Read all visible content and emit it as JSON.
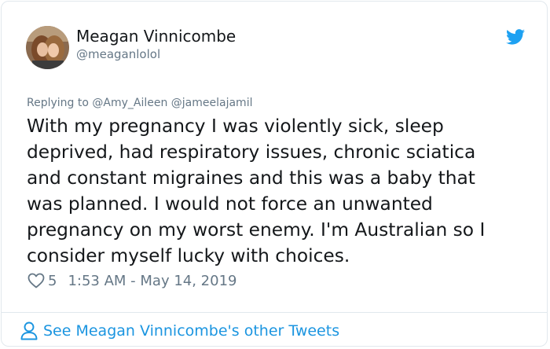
{
  "user": {
    "display_name": "Meagan Vinnicombe",
    "handle": "@meaganlolol",
    "avatar_icon": "profile-photo"
  },
  "brand": {
    "icon": "twitter-bird-icon",
    "color": "#1da1f2"
  },
  "tweet": {
    "replying_to": "Replying to @Amy_Aileen @jameelajamil",
    "lines": [
      "With my pregnancy I was violently sick, sleep",
      "deprived, had respiratory issues, chronic sciatica",
      "and constant migraines and this was a baby that",
      "was planned. I would not force an unwanted",
      "pregnancy on my worst enemy. I'm Australian so I",
      "consider myself lucky with choices."
    ],
    "like_count": "5",
    "timestamp": "1:53 AM - May 14, 2019"
  },
  "footer": {
    "link_label": "See Meagan Vinnicombe's other Tweets",
    "icon": "person-icon",
    "link_color": "#1b95e0"
  }
}
